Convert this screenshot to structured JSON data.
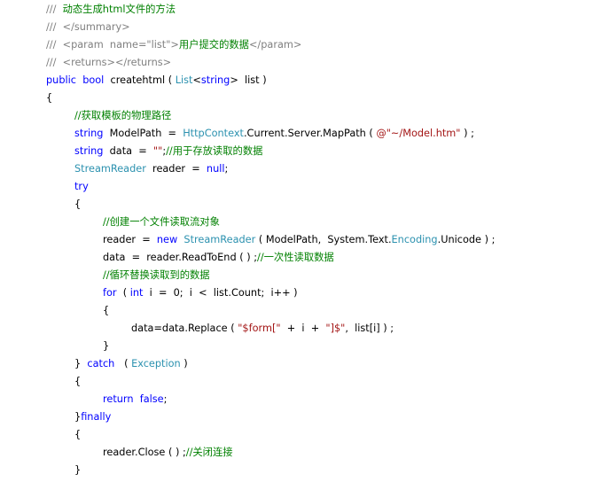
{
  "colors": {
    "keyword": "#0000ff",
    "type": "#2b91af",
    "string": "#a31515",
    "comment": "#008000",
    "doc": "#808080",
    "plain": "#000000",
    "background": "#ffffff"
  },
  "lines": [
    {
      "indent": 0,
      "tokens": [
        {
          "t": "///  ",
          "c": "doc"
        },
        {
          "t": "动态生成html文件的方法",
          "c": "cm"
        }
      ]
    },
    {
      "indent": 0,
      "tokens": [
        {
          "t": "///  </summary>",
          "c": "doc"
        }
      ]
    },
    {
      "indent": 0,
      "tokens": [
        {
          "t": "///  <param  name=\"list\">",
          "c": "doc"
        },
        {
          "t": "用户提交的数据",
          "c": "cm"
        },
        {
          "t": "</param>",
          "c": "doc"
        }
      ]
    },
    {
      "indent": 0,
      "tokens": [
        {
          "t": "///  <returns></returns>",
          "c": "doc"
        }
      ]
    },
    {
      "indent": 0,
      "tokens": [
        {
          "t": "public",
          "c": "kw"
        },
        {
          "t": "  ",
          "c": "plain"
        },
        {
          "t": "bool",
          "c": "kw"
        },
        {
          "t": "  createhtml ( ",
          "c": "plain"
        },
        {
          "t": "List",
          "c": "type"
        },
        {
          "t": "<",
          "c": "plain"
        },
        {
          "t": "string",
          "c": "kw"
        },
        {
          "t": ">  list )",
          "c": "plain"
        }
      ]
    },
    {
      "indent": 0,
      "tokens": [
        {
          "t": "{",
          "c": "plain"
        }
      ]
    },
    {
      "indent": 1,
      "tokens": [
        {
          "t": "//获取模板的物理路径",
          "c": "cm"
        }
      ]
    },
    {
      "indent": 1,
      "tokens": [
        {
          "t": "string",
          "c": "kw"
        },
        {
          "t": "  ModelPath  =  ",
          "c": "plain"
        },
        {
          "t": "HttpContext",
          "c": "type"
        },
        {
          "t": ".Current.Server.MapPath ( ",
          "c": "plain"
        },
        {
          "t": "@\"~/Model.htm\"",
          "c": "str"
        },
        {
          "t": " ) ;",
          "c": "plain"
        }
      ]
    },
    {
      "indent": 1,
      "tokens": [
        {
          "t": "string",
          "c": "kw"
        },
        {
          "t": "  data  =  ",
          "c": "plain"
        },
        {
          "t": "\"\"",
          "c": "str"
        },
        {
          "t": ";",
          "c": "plain"
        },
        {
          "t": "//用于存放读取的数据",
          "c": "cm"
        }
      ]
    },
    {
      "indent": 1,
      "tokens": [
        {
          "t": "StreamReader",
          "c": "type"
        },
        {
          "t": "  reader  =  ",
          "c": "plain"
        },
        {
          "t": "null",
          "c": "kw"
        },
        {
          "t": ";",
          "c": "plain"
        }
      ]
    },
    {
      "indent": 1,
      "tokens": [
        {
          "t": "try",
          "c": "kw"
        }
      ]
    },
    {
      "indent": 1,
      "tokens": [
        {
          "t": "{",
          "c": "plain"
        }
      ]
    },
    {
      "indent": 2,
      "tokens": [
        {
          "t": "//创建一个文件读取流对象",
          "c": "cm"
        }
      ]
    },
    {
      "indent": 2,
      "tokens": [
        {
          "t": "reader  =  ",
          "c": "plain"
        },
        {
          "t": "new",
          "c": "kw"
        },
        {
          "t": "  ",
          "c": "plain"
        },
        {
          "t": "StreamReader",
          "c": "type"
        },
        {
          "t": " ( ModelPath,  System.Text.",
          "c": "plain"
        },
        {
          "t": "Encoding",
          "c": "type"
        },
        {
          "t": ".Unicode ) ;",
          "c": "plain"
        }
      ]
    },
    {
      "indent": 2,
      "tokens": [
        {
          "t": "data  =  reader.ReadToEnd ( ) ;",
          "c": "plain"
        },
        {
          "t": "//一次性读取数据",
          "c": "cm"
        }
      ]
    },
    {
      "indent": 2,
      "tokens": [
        {
          "t": "//循环替换读取到的数据",
          "c": "cm"
        }
      ]
    },
    {
      "indent": 2,
      "tokens": [
        {
          "t": "for",
          "c": "kw"
        },
        {
          "t": "  ( ",
          "c": "plain"
        },
        {
          "t": "int",
          "c": "kw"
        },
        {
          "t": "  i  =  0;  i  <  list.Count;  i++ )",
          "c": "plain"
        }
      ]
    },
    {
      "indent": 2,
      "tokens": [
        {
          "t": "{",
          "c": "plain"
        }
      ]
    },
    {
      "indent": 3,
      "tokens": [
        {
          "t": "data=data.Replace ( ",
          "c": "plain"
        },
        {
          "t": "\"$form[\"",
          "c": "str"
        },
        {
          "t": "  +  i  +  ",
          "c": "plain"
        },
        {
          "t": "\"]$\"",
          "c": "str"
        },
        {
          "t": ",  list[i] ) ;",
          "c": "plain"
        }
      ]
    },
    {
      "indent": 2,
      "tokens": [
        {
          "t": "}",
          "c": "plain"
        }
      ]
    },
    {
      "indent": 1,
      "tokens": [
        {
          "t": "}  ",
          "c": "plain"
        },
        {
          "t": "catch",
          "c": "kw"
        },
        {
          "t": "   ( ",
          "c": "plain"
        },
        {
          "t": "Exception",
          "c": "type"
        },
        {
          "t": " )",
          "c": "plain"
        }
      ]
    },
    {
      "indent": 1,
      "tokens": [
        {
          "t": "{",
          "c": "plain"
        }
      ]
    },
    {
      "indent": 2,
      "tokens": [
        {
          "t": "return",
          "c": "kw"
        },
        {
          "t": "  ",
          "c": "plain"
        },
        {
          "t": "false",
          "c": "kw"
        },
        {
          "t": ";",
          "c": "plain"
        }
      ]
    },
    {
      "indent": 1,
      "tokens": [
        {
          "t": "}",
          "c": "plain"
        },
        {
          "t": "finally",
          "c": "kw"
        }
      ]
    },
    {
      "indent": 1,
      "tokens": [
        {
          "t": "{",
          "c": "plain"
        }
      ]
    },
    {
      "indent": 2,
      "tokens": [
        {
          "t": "reader.Close ( ) ;",
          "c": "plain"
        },
        {
          "t": "//关闭连接",
          "c": "cm"
        }
      ]
    },
    {
      "indent": 1,
      "tokens": [
        {
          "t": "}",
          "c": "plain"
        }
      ]
    }
  ]
}
